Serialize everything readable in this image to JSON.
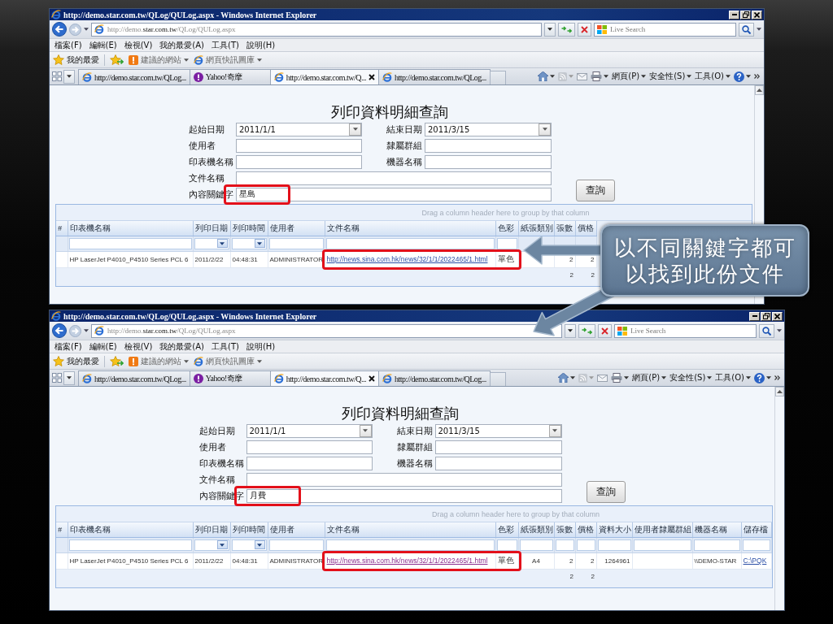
{
  "slide": {
    "callout": "以不同關鍵字都可以找到此份文件"
  },
  "windows": [
    {
      "title": "http://demo.star.com.tw/QLog/QULog.aspx - Windows Internet Explorer",
      "address": {
        "prefix": "http://demo.",
        "domain": "star.com.tw",
        "path": "/QLog/QULog.aspx"
      },
      "search": {
        "placeholder": "Live Search"
      },
      "menu": [
        "檔案(F)",
        "編輯(E)",
        "檢視(V)",
        "我的最愛(A)",
        "工具(T)",
        "說明(H)"
      ],
      "favorites": {
        "label": "我的最愛",
        "links": [
          {
            "label": "建議的網站",
            "kind": "suggested"
          },
          {
            "label": "網頁快訊圖庫",
            "kind": "gallery"
          }
        ]
      },
      "tabs": [
        {
          "label": "http://demo.star.com.tw/QLog...",
          "kind": "page",
          "selected": false
        },
        {
          "label": "Yahoo!奇摩",
          "kind": "yahoo",
          "selected": false
        },
        {
          "label": "http://demo.star.com.tw/Q...",
          "kind": "page",
          "selected": true
        },
        {
          "label": "http://demo.star.com.tw/QLog...",
          "kind": "page",
          "selected": false
        }
      ],
      "commands": [
        "網頁(P)",
        "安全性(S)",
        "工具(O)"
      ],
      "page": {
        "title": "列印資料明細查詢",
        "fields": [
          {
            "label": "起始日期",
            "value": "2011/1/1",
            "kind": "dropdown",
            "highlighted": false
          },
          {
            "label": "結束日期",
            "value": "2011/3/15",
            "kind": "dropdown",
            "highlighted": false
          },
          {
            "label": "使用者",
            "kind": "text",
            "highlighted": false
          },
          {
            "label": "隸屬群組",
            "kind": "text",
            "highlighted": false
          },
          {
            "label": "印表機名稱",
            "kind": "text",
            "highlighted": false
          },
          {
            "label": "機器名稱",
            "kind": "text",
            "highlighted": false
          },
          {
            "label": "文件名稱",
            "kind": "wide",
            "highlighted": false
          },
          {
            "label": "內容關鍵字",
            "value": "星島",
            "kind": "wide",
            "highlighted": true
          }
        ],
        "button": "查詢",
        "grid": {
          "group_hint": "Drag a column header here to group by that column",
          "columns": [
            {
              "label": "#",
              "kind": "index"
            },
            {
              "label": "印表機名稱",
              "kind": "text",
              "filter": {
                "kind": "text"
              },
              "value": "HP LaserJet P4010_P4510 Series PCL 6"
            },
            {
              "label": "列印日期",
              "kind": "text",
              "filter": {
                "kind": "dropdown"
              },
              "value": "2011/2/22"
            },
            {
              "label": "列印時間",
              "kind": "text",
              "filter": {
                "kind": "dropdown"
              },
              "value": "04:48:31"
            },
            {
              "label": "使用者",
              "kind": "text",
              "filter": {
                "kind": "text"
              },
              "value": "ADMINISTRATOR"
            },
            {
              "label": "文件名稱",
              "kind": "link",
              "filter": {
                "kind": "text"
              },
              "value": {
                "text": "http://news.sina.com.hk/news/32/1/1/2022465/1.html",
                "visited": false,
                "highlighted": true
              }
            },
            {
              "label": "色彩",
              "kind": "word",
              "filter": {
                "kind": "text"
              },
              "value": "單色"
            },
            {
              "label": "紙張類別",
              "kind": "code"
            },
            {
              "label": "張數",
              "kind": "number",
              "value": "2",
              "total": "2"
            },
            {
              "label": "價格",
              "kind": "number",
              "value": "2",
              "total": "2"
            }
          ]
        }
      }
    },
    {
      "title": "http://demo.star.com.tw/QLog/QULog.aspx - Windows Internet Explorer",
      "address": {
        "prefix": "http://demo.",
        "domain": "star.com.tw",
        "path": "/QLog/QULog.aspx"
      },
      "search": {
        "placeholder": "Live Search"
      },
      "menu": [
        "檔案(F)",
        "編輯(E)",
        "檢視(V)",
        "我的最愛(A)",
        "工具(T)",
        "說明(H)"
      ],
      "favorites": {
        "label": "我的最愛",
        "links": [
          {
            "label": "建議的網站",
            "kind": "suggested"
          },
          {
            "label": "網頁快訊圖庫",
            "kind": "gallery"
          }
        ]
      },
      "tabs": [
        {
          "label": "http://demo.star.com.tw/QLog...",
          "kind": "page",
          "selected": false
        },
        {
          "label": "Yahoo!奇摩",
          "kind": "yahoo",
          "selected": false
        },
        {
          "label": "http://demo.star.com.tw/Q...",
          "kind": "page",
          "selected": true
        },
        {
          "label": "http://demo.star.com.tw/QLog...",
          "kind": "page",
          "selected": false
        }
      ],
      "commands": [
        "網頁(P)",
        "安全性(S)",
        "工具(O)"
      ],
      "page": {
        "title": "列印資料明細查詢",
        "fields": [
          {
            "label": "起始日期",
            "value": "2011/1/1",
            "kind": "dropdown",
            "highlighted": false
          },
          {
            "label": "結束日期",
            "value": "2011/3/15",
            "kind": "dropdown",
            "highlighted": false
          },
          {
            "label": "使用者",
            "kind": "text",
            "highlighted": false
          },
          {
            "label": "隸屬群組",
            "kind": "text",
            "highlighted": false
          },
          {
            "label": "印表機名稱",
            "kind": "text",
            "highlighted": false
          },
          {
            "label": "機器名稱",
            "kind": "text",
            "highlighted": false
          },
          {
            "label": "文件名稱",
            "kind": "wide",
            "highlighted": false
          },
          {
            "label": "內容關鍵字",
            "value": "月費",
            "kind": "wide",
            "highlighted": true
          }
        ],
        "button": "查詢",
        "grid": {
          "group_hint": "Drag a column header here to group by that column",
          "columns": [
            {
              "label": "#",
              "kind": "index"
            },
            {
              "label": "印表機名稱",
              "kind": "text",
              "filter": {
                "kind": "text"
              },
              "value": "HP LaserJet P4010_P4510 Series PCL 6"
            },
            {
              "label": "列印日期",
              "kind": "text",
              "filter": {
                "kind": "dropdown"
              },
              "value": "2011/2/22"
            },
            {
              "label": "列印時間",
              "kind": "text",
              "filter": {
                "kind": "dropdown"
              },
              "value": "04:48:31"
            },
            {
              "label": "使用者",
              "kind": "text",
              "filter": {
                "kind": "text"
              },
              "value": "ADMINISTRATOR"
            },
            {
              "label": "文件名稱",
              "kind": "link",
              "filter": {
                "kind": "text"
              },
              "value": {
                "text": "http://news.sina.com.hk/news/32/1/1/2022465/1.html",
                "visited": true,
                "highlighted": true
              }
            },
            {
              "label": "色彩",
              "kind": "word",
              "filter": {
                "kind": "text"
              },
              "value": "單色"
            },
            {
              "label": "紙張類別",
              "kind": "code",
              "filter": {
                "kind": "text"
              },
              "value": "A4"
            },
            {
              "label": "張數",
              "kind": "number",
              "filter": {
                "kind": "text"
              },
              "value": "2",
              "total": "2"
            },
            {
              "label": "價格",
              "kind": "number",
              "filter": {
                "kind": "text"
              },
              "value": "2",
              "total": "2"
            },
            {
              "label": "資料大小",
              "kind": "number",
              "filter": {
                "kind": "text"
              },
              "value": "1264961"
            },
            {
              "label": "使用者隸屬群組",
              "kind": "text",
              "filter": {
                "kind": "text"
              }
            },
            {
              "label": "機器名稱",
              "kind": "text",
              "filter": {
                "kind": "text"
              },
              "value": "\\\\DEMO-STAR"
            },
            {
              "label": "儲存檔",
              "kind": "link",
              "filter": {
                "kind": "text"
              },
              "value": {
                "text": "C:\\PQK",
                "visited": false,
                "highlighted": false
              }
            }
          ]
        }
      }
    }
  ]
}
